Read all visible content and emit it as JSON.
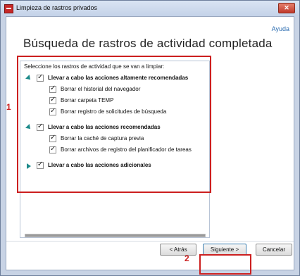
{
  "window": {
    "title": "Limpieza de rastros privados",
    "close_glyph": "✕"
  },
  "header": {
    "help": "Ayuda",
    "page_title": "Búsqueda de rastros de actividad completada"
  },
  "panel": {
    "caption": "Seleccione los rastros de actividad que se van a limpiar:",
    "groups": [
      {
        "label": "Llevar a cabo las acciones altamente recomendadas",
        "expanded": true,
        "checked": true,
        "items": [
          {
            "label": "Borrar el historial del navegador",
            "checked": true
          },
          {
            "label": "Borrar carpeta TEMP",
            "checked": true
          },
          {
            "label": "Borrar registro de solicitudes de búsqueda",
            "checked": true
          }
        ]
      },
      {
        "label": "Llevar a cabo las acciones recomendadas",
        "expanded": true,
        "checked": true,
        "items": [
          {
            "label": "Borrar la caché de captura previa",
            "checked": true
          },
          {
            "label": "Borrar archivos de registro del planificador de tareas",
            "checked": true
          }
        ]
      },
      {
        "label": "Llevar a cabo las acciones adicionales",
        "expanded": false,
        "checked": true,
        "items": []
      }
    ]
  },
  "buttons": {
    "back": "< Atrás",
    "next": "Siguiente >",
    "cancel": "Cancelar"
  },
  "annotations": {
    "marker_1": "1",
    "marker_2": "2",
    "color": "#cc1f1f"
  },
  "colors": {
    "accent": "#1c8a8a",
    "link": "#2b6cb0"
  }
}
